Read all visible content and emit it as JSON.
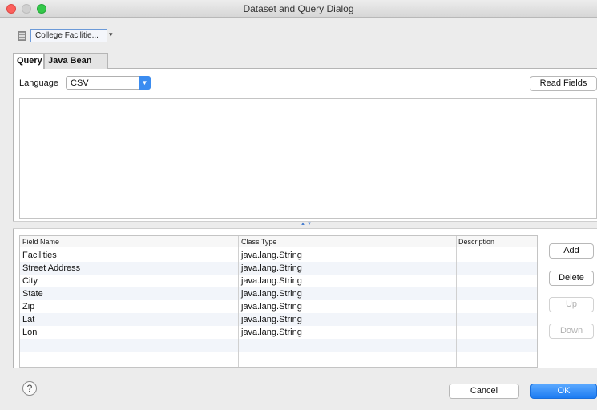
{
  "window": {
    "title": "Dataset and Query Dialog"
  },
  "datasource": {
    "selected": "College Facilitie...",
    "arrow_glyph": "▾"
  },
  "tabs": [
    {
      "label": "Query"
    },
    {
      "label": "Java Bean"
    }
  ],
  "query": {
    "language_label": "Language",
    "language_value": "CSV",
    "read_fields_label": "Read Fields",
    "text": ""
  },
  "table": {
    "headers": [
      "Field Name",
      "Class Type",
      "Description"
    ],
    "rows": [
      {
        "field": "Facilities",
        "type": "java.lang.String",
        "description": ""
      },
      {
        "field": "Street Address",
        "type": "java.lang.String",
        "description": ""
      },
      {
        "field": "City",
        "type": "java.lang.String",
        "description": ""
      },
      {
        "field": "State",
        "type": "java.lang.String",
        "description": ""
      },
      {
        "field": "Zip",
        "type": "java.lang.String",
        "description": ""
      },
      {
        "field": "Lat",
        "type": "java.lang.String",
        "description": ""
      },
      {
        "field": "Lon",
        "type": "java.lang.String",
        "description": ""
      }
    ]
  },
  "side_buttons": {
    "add": "Add",
    "delete": "Delete",
    "up": "Up",
    "down": "Down"
  },
  "footer": {
    "help_glyph": "?",
    "cancel": "Cancel",
    "ok": "OK"
  },
  "colors": {
    "accent": "#1d7cf2",
    "close": "#fc605c",
    "zoom": "#34c84a"
  }
}
